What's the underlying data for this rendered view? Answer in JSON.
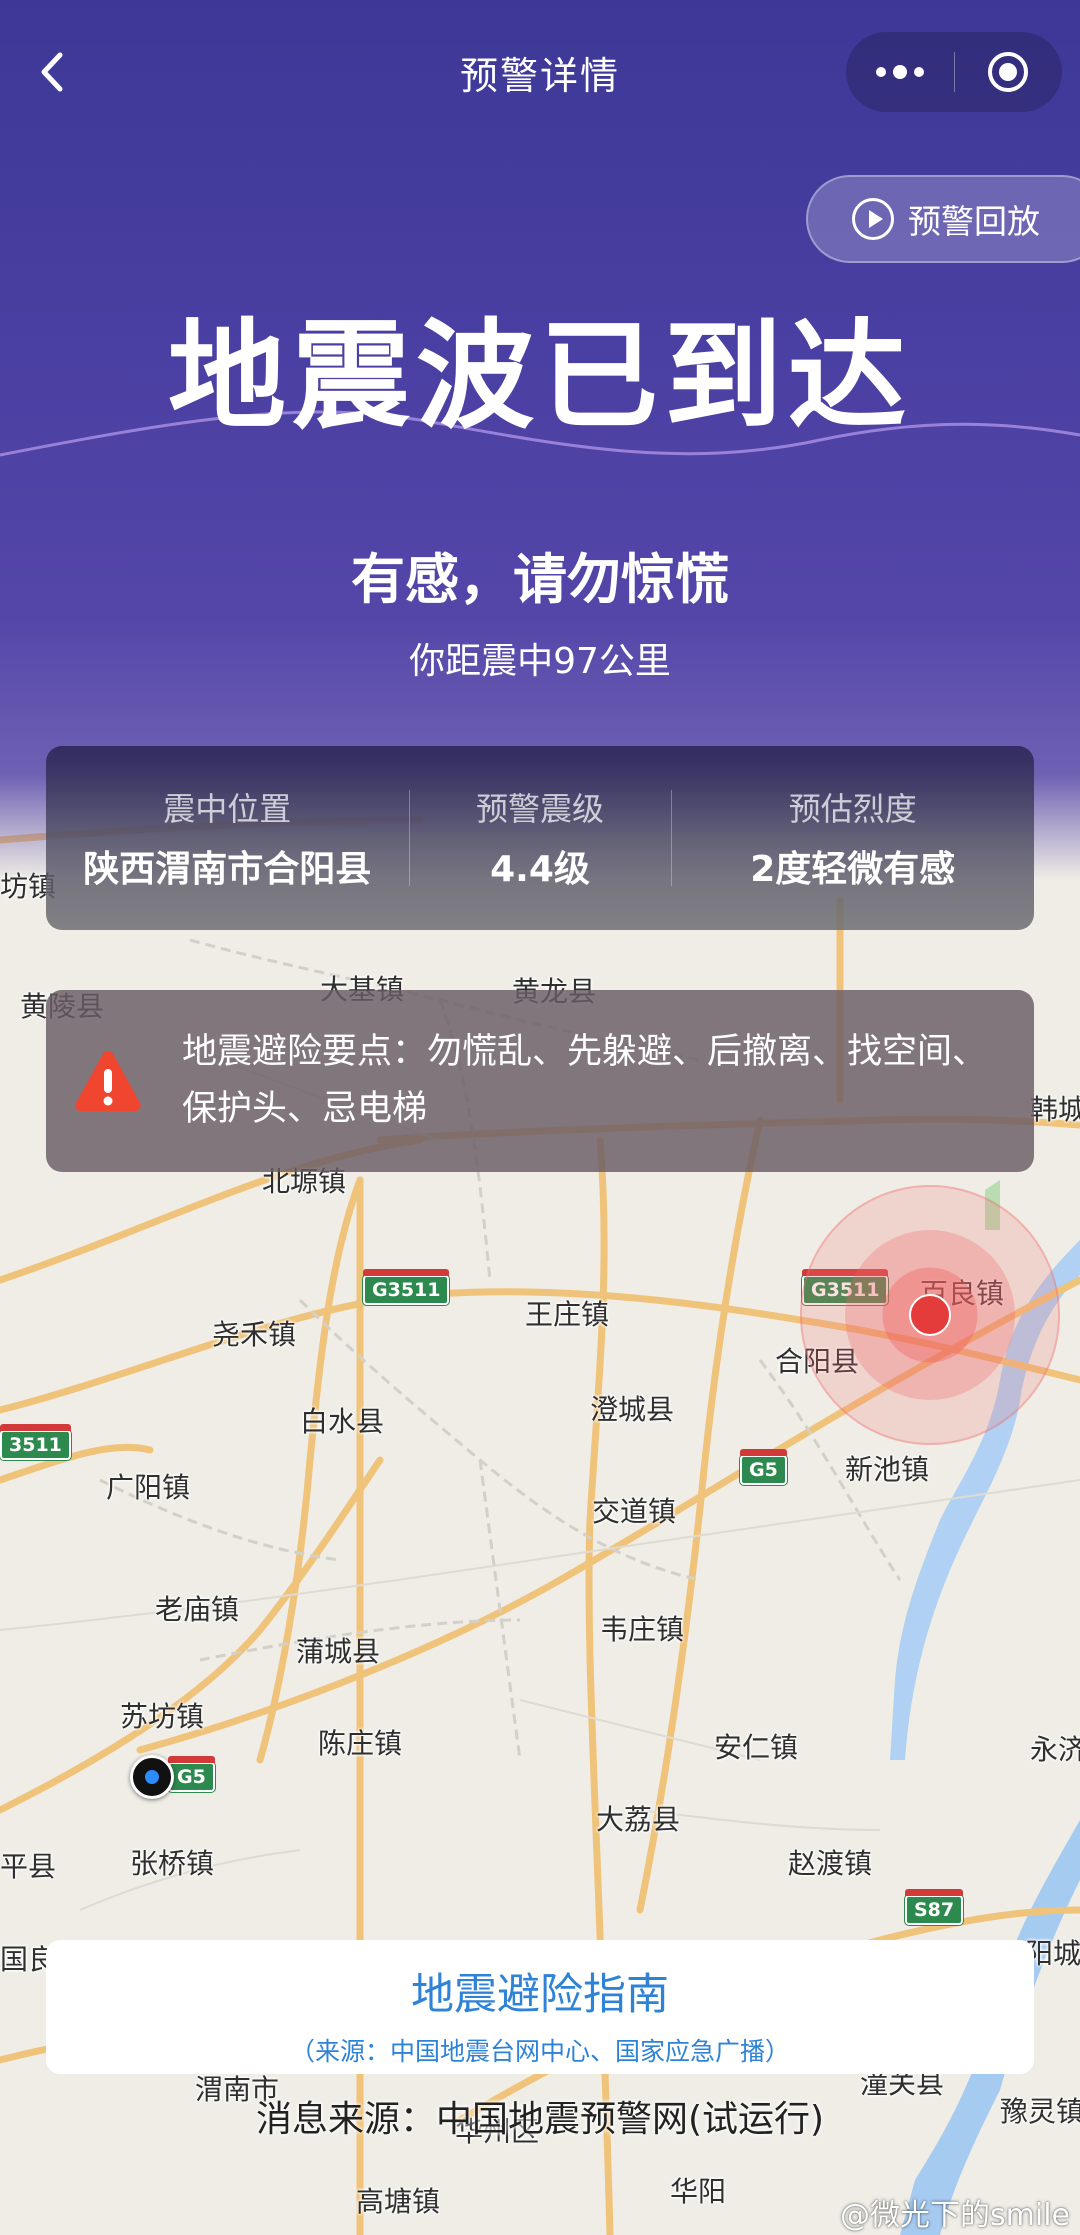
{
  "header": {
    "title": "预警详情",
    "back_icon": "chevron-left-icon",
    "more_icon": "more-dots-icon",
    "close_icon": "target-circle-icon"
  },
  "hero": {
    "replay_label": "预警回放",
    "headline": "地震波已到达",
    "subline": "有感，请勿惊慌",
    "distance": "你距震中97公里"
  },
  "info": {
    "epicenter_label": "震中位置",
    "epicenter_value": "陕西渭南市合阳县",
    "magnitude_label": "预警震级",
    "magnitude_value": "4.4级",
    "intensity_label": "预估烈度",
    "intensity_value": "2度轻微有感"
  },
  "alert": {
    "icon": "warning-triangle-icon",
    "text": "地震避险要点：勿慌乱、先躲避、后撤离、找空间、保护头、忌电梯"
  },
  "map": {
    "places": [
      "黄陵县",
      "大基镇",
      "黄龙县",
      "韩城",
      "北塬镇",
      "尧禾镇",
      "王庄镇",
      "百良镇",
      "合阳县",
      "白水县",
      "澄城县",
      "新池镇",
      "广阳镇",
      "交道镇",
      "老庙镇",
      "蒲城县",
      "韦庄镇",
      "苏坊镇",
      "陈庄镇",
      "安仁镇",
      "永济",
      "大荔县",
      "张桥镇",
      "赵渡镇",
      "平县",
      "阳城",
      "国良",
      "渭南市",
      "华州区",
      "潼关县",
      "豫灵镇",
      "高塘镇",
      "华阳",
      "坊镇"
    ],
    "shields": [
      "G3511",
      "G3511",
      "G5",
      "G5",
      "S87",
      "3511"
    ]
  },
  "guide": {
    "title": "地震避险指南",
    "source": "（来源：中国地震台网中心、国家应急广播）"
  },
  "message_source": "消息来源：中国地震预警网(试运行)",
  "watermark": "@微光下的smile",
  "colors": {
    "hero": "#3d3897",
    "accent": "#2f83d6",
    "epicenter": "#e43b3b",
    "alert": "#f0452e"
  }
}
